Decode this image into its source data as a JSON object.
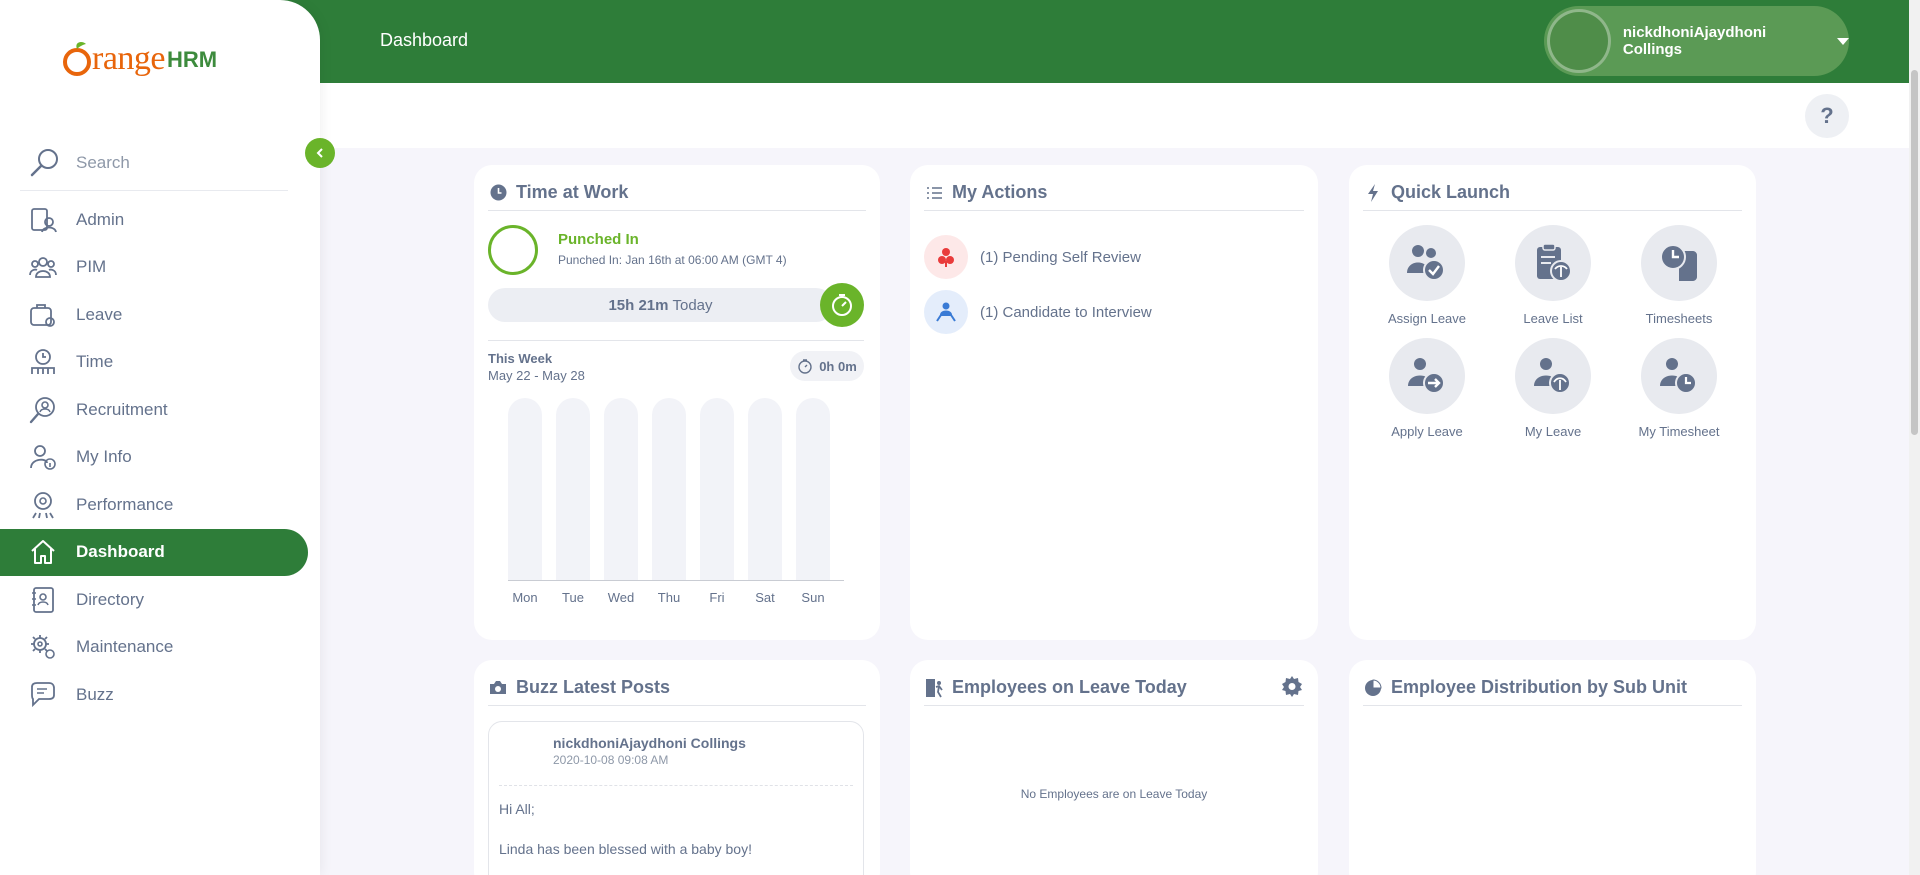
{
  "app": {
    "logo_text_main": "range",
    "logo_text_sub": "HRM",
    "logo_letter": "O"
  },
  "header": {
    "title": "Dashboard",
    "user_name": "nickdhoniAjaydhoni Collings",
    "help_label": "?"
  },
  "search": {
    "placeholder": "Search"
  },
  "sidebar": {
    "items": [
      {
        "label": "Admin",
        "icon": "admin-icon"
      },
      {
        "label": "PIM",
        "icon": "pim-icon"
      },
      {
        "label": "Leave",
        "icon": "leave-icon"
      },
      {
        "label": "Time",
        "icon": "time-icon"
      },
      {
        "label": "Recruitment",
        "icon": "recruitment-icon"
      },
      {
        "label": "My Info",
        "icon": "my-info-icon"
      },
      {
        "label": "Performance",
        "icon": "performance-icon"
      },
      {
        "label": "Dashboard",
        "icon": "home-icon",
        "active": true
      },
      {
        "label": "Directory",
        "icon": "directory-icon"
      },
      {
        "label": "Maintenance",
        "icon": "maintenance-icon"
      },
      {
        "label": "Buzz",
        "icon": "buzz-icon"
      }
    ]
  },
  "time_at_work": {
    "title": "Time at Work",
    "status": "Punched In",
    "punched_in_detail": "Punched In: Jan 16th at 06:00 AM (GMT 4)",
    "today_hours": "15h 21m",
    "today_label": "Today",
    "week_title": "This Week",
    "week_range": "May 22 - May 28",
    "week_total": "0h 0m",
    "days": [
      "Mon",
      "Tue",
      "Wed",
      "Thu",
      "Fri",
      "Sat",
      "Sun"
    ]
  },
  "my_actions": {
    "title": "My Actions",
    "items": [
      {
        "label": "(1) Pending Self Review",
        "icon": "self-review-icon",
        "color": "#e93b3b"
      },
      {
        "label": "(1) Candidate to Interview",
        "icon": "interview-icon",
        "color": "#3a7bd5"
      }
    ]
  },
  "quick_launch": {
    "title": "Quick Launch",
    "items": [
      {
        "label": "Assign Leave",
        "icon": "assign-leave-icon"
      },
      {
        "label": "Leave List",
        "icon": "leave-list-icon"
      },
      {
        "label": "Timesheets",
        "icon": "timesheets-icon"
      },
      {
        "label": "Apply Leave",
        "icon": "apply-leave-icon"
      },
      {
        "label": "My Leave",
        "icon": "my-leave-icon"
      },
      {
        "label": "My Timesheet",
        "icon": "my-timesheet-icon"
      }
    ]
  },
  "buzz": {
    "title": "Buzz Latest Posts",
    "post": {
      "author": "nickdhoniAjaydhoni Collings",
      "date": "2020-10-08 09:08 AM",
      "line1": "Hi All;",
      "line2": "Linda has been blessed with a baby boy!"
    }
  },
  "employees_on_leave": {
    "title": "Employees on Leave Today",
    "empty_message": "No Employees are on Leave Today"
  },
  "distribution": {
    "title": "Employee Distribution by Sub Unit"
  },
  "colors": {
    "brand_green": "#2e7d39",
    "accent_green": "#6ab42a",
    "brand_orange": "#e8650b",
    "text": "#64728c"
  }
}
